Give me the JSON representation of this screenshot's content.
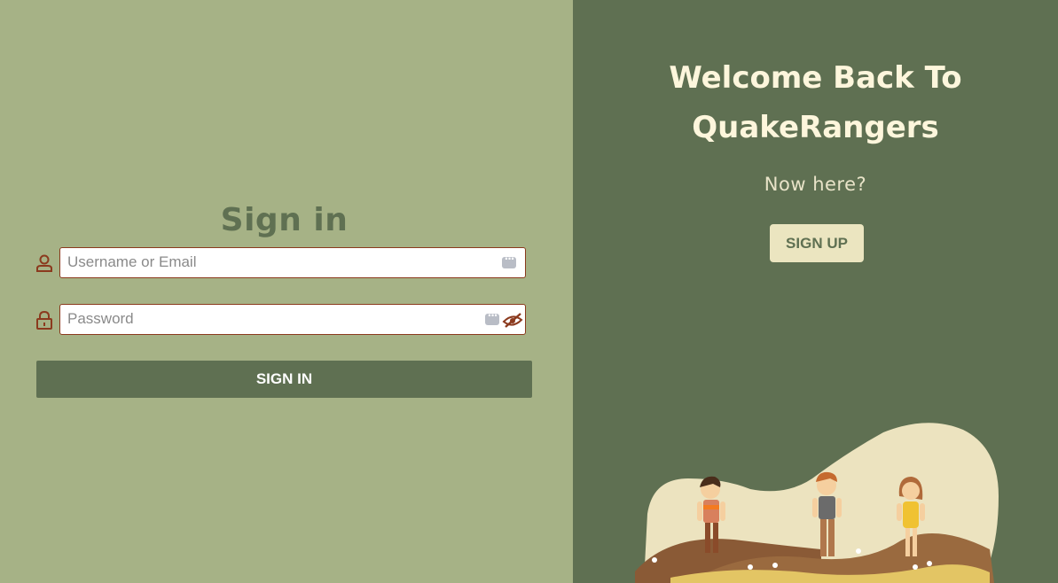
{
  "signin": {
    "title": "Sign in",
    "username_placeholder": "Username or Email",
    "password_placeholder": "Password",
    "button_label": "SIGN IN"
  },
  "welcome_panel": {
    "title_line1": "Welcome Back To",
    "title_line2": "QuakeRangers",
    "prompt": "Now here?",
    "signup_label": "SIGN UP"
  },
  "icons": {
    "username": "user-icon",
    "password": "lock-icon",
    "autofill": "keyboard-autofill-icon",
    "toggle_password": "eye-slash-icon"
  },
  "colors": {
    "left_bg": "#a6b286",
    "right_bg": "#5f7052",
    "accent_dark": "#5f7052",
    "input_border": "#8b3a1e",
    "cream": "#fdf6dc"
  }
}
